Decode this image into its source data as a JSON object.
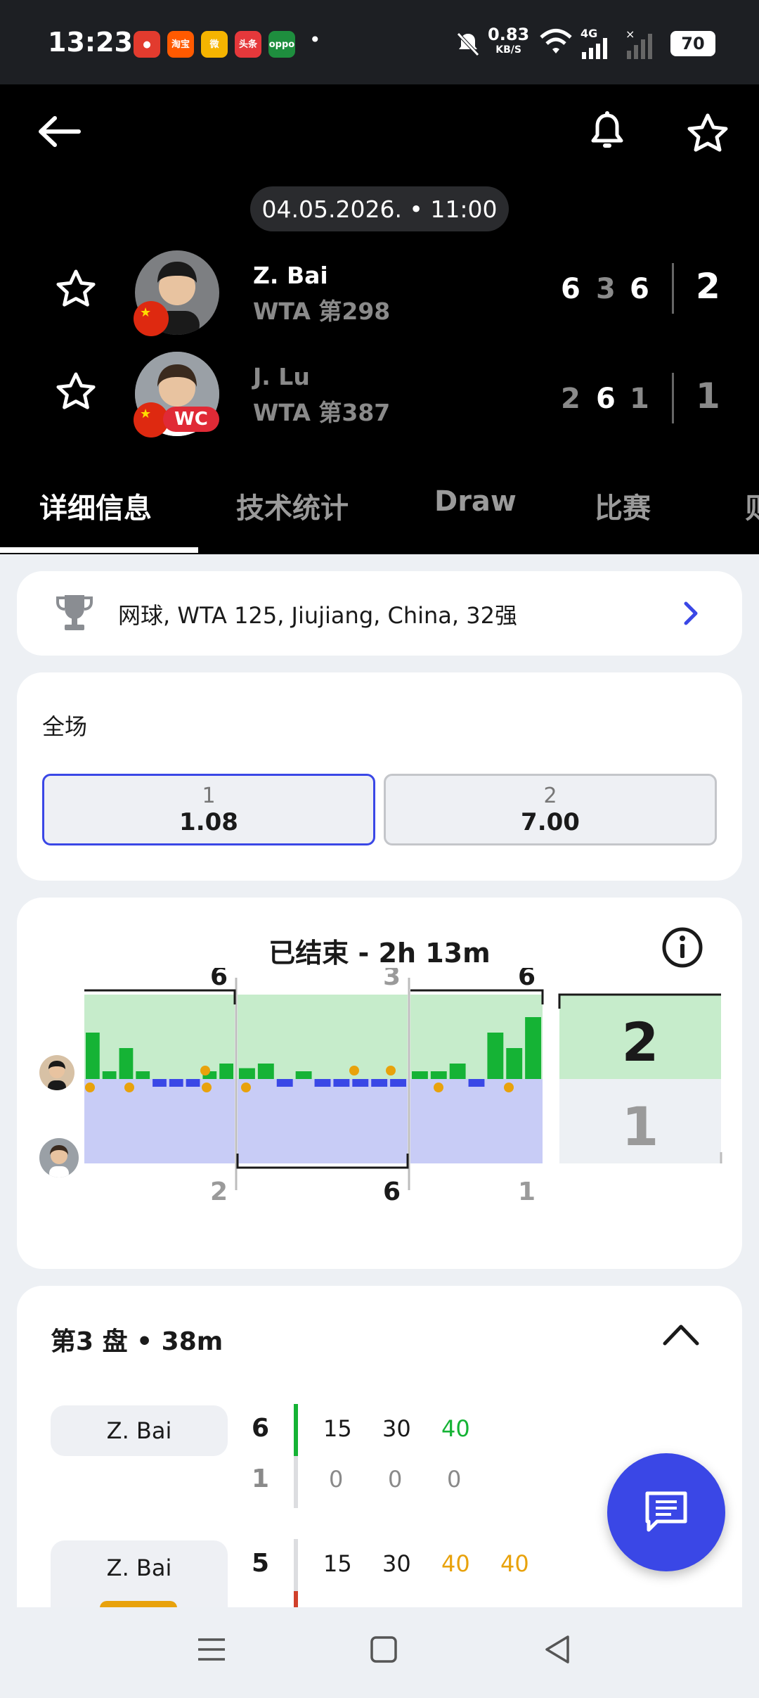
{
  "status_bar": {
    "time": "13:23",
    "net_speed": "0.83",
    "net_unit": "KB/S",
    "net_type": "4G",
    "battery": "70",
    "apps": [
      {
        "name": "app-icon-1",
        "color": "#e23b2e",
        "text": "●"
      },
      {
        "name": "taobao-flash-icon",
        "color": "#ff5a00",
        "text": "淘宝"
      },
      {
        "name": "weibo-icon",
        "color": "#f5b400",
        "text": "微"
      },
      {
        "name": "toutiao-icon",
        "color": "#e5383b",
        "text": "头条"
      },
      {
        "name": "oppo-icon",
        "color": "#1e8e3e",
        "text": "oppo"
      }
    ],
    "dot": "•"
  },
  "match": {
    "datetime": "04.05.2026. • 11:00",
    "players": [
      {
        "name": "Z. Bai",
        "rank": "WTA 第298",
        "sets": [
          "6",
          "3",
          "6"
        ],
        "sets_won": "2",
        "set_winner": [
          true,
          false,
          true
        ]
      },
      {
        "name": "J. Lu",
        "rank": "WTA 第387",
        "sets": [
          "2",
          "6",
          "1"
        ],
        "sets_won": "1",
        "badge": "WC",
        "set_winner": [
          false,
          true,
          false
        ]
      }
    ]
  },
  "tabs": [
    "详细信息",
    "技术统计",
    "Draw",
    "比赛",
    "则"
  ],
  "tournament": {
    "label": "网球, WTA 125, Jiujiang, China, 32强"
  },
  "odds": {
    "title": "全场",
    "options": [
      {
        "label": "1",
        "value": "1.08",
        "selected": true
      },
      {
        "label": "2",
        "value": "7.00",
        "selected": false
      }
    ]
  },
  "momentum": {
    "title": "已结束 - 2h 13m",
    "set_scores_top": [
      "6",
      "3",
      "6"
    ],
    "set_scores_bottom": [
      "2",
      "6",
      "1"
    ],
    "total_top": "2",
    "total_bottom": "1",
    "chart_data": {
      "type": "bar",
      "sets": 3,
      "values_set1": [
        3,
        0.5,
        2,
        0.5,
        -0.5,
        -0.5,
        -0.5,
        0.5,
        1
      ],
      "values_set2": [
        0.7,
        1,
        -0.5,
        0.5,
        -0.5,
        -0.5,
        -0.5,
        -0.5,
        -0.5
      ],
      "values_set3": [
        0.5,
        0.5,
        1,
        -0.5,
        3,
        2,
        4
      ]
    }
  },
  "set3": {
    "title": "第3 盘 • 38m",
    "rows": [
      {
        "player": "Z. Bai",
        "games_top": "6",
        "games_bottom": "1",
        "points_top": [
          "15",
          "30",
          "40"
        ],
        "points_bottom": [
          "0",
          "0",
          "0"
        ]
      },
      {
        "player": "Z. Bai",
        "games_top": "5",
        "points_top": [
          "15",
          "30",
          "40",
          "40"
        ]
      }
    ]
  },
  "colors": {
    "accent": "#3a47e6",
    "green": "#15b335",
    "blue": "#3a47e6",
    "win_green_bg": "#c6eccb",
    "lose_blue_bg": "#c8ccf6",
    "gold": "#e8a20c"
  }
}
